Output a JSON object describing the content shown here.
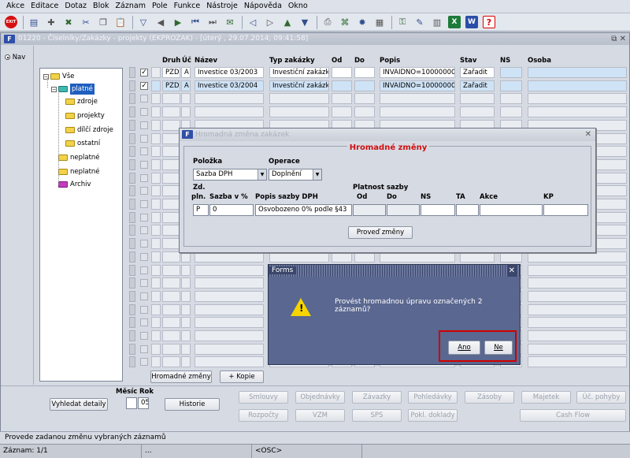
{
  "menu": [
    "Akce",
    "Editace",
    "Dotaz",
    "Blok",
    "Záznam",
    "Pole",
    "Funkce",
    "Nástroje",
    "Nápověda",
    "Okno"
  ],
  "toolbar": {
    "exit_label": "EXIT",
    "icons": [
      "exit-icon",
      "save-icon",
      "new-record-icon",
      "clear-icon",
      "cut-icon",
      "copy-icon",
      "paste-icon",
      "filter-icon",
      "prev-icon",
      "next-icon",
      "first-icon",
      "last-icon",
      "email-icon",
      "prev-record-icon",
      "next-record-icon",
      "up-icon",
      "down-icon",
      "print-icon",
      "attach-icon",
      "settings-icon",
      "calculator-icon",
      "key-icon",
      "edit-icon",
      "table-icon",
      "excel-icon",
      "word-icon",
      "help-icon"
    ]
  },
  "form": {
    "title": "01220 - Číselníky/Zakázky - projekty (EKPROZAK) - [úterý , 29.07.2014; 09:41:58]",
    "nav_label": "Nav",
    "tree": [
      {
        "label": "Vše",
        "level": 0,
        "color": "yellow",
        "toggle": "−"
      },
      {
        "label": "platné",
        "level": 1,
        "color": "teal",
        "toggle": "−",
        "selected": true
      },
      {
        "label": "zdroje",
        "level": 2,
        "color": "yellow"
      },
      {
        "label": "projekty",
        "level": 2,
        "color": "yellow"
      },
      {
        "label": "dílčí zdroje",
        "level": 2,
        "color": "yellow"
      },
      {
        "label": "ostatní",
        "level": 2,
        "color": "yellow"
      },
      {
        "label": "neplatné",
        "level": 1,
        "color": "yellow"
      },
      {
        "label": "neplatné",
        "level": 1,
        "color": "yellow"
      },
      {
        "label": "Archiv",
        "level": 1,
        "color": "magenta"
      }
    ],
    "columns": [
      "Druh",
      "Úč",
      "Název",
      "Typ zakázky",
      "Od",
      "Do",
      "Popis",
      "Stav",
      "NS",
      "Osoba"
    ],
    "rows": [
      {
        "checked": "✓",
        "druh": "PZD",
        "uc": "A",
        "nazev": "Investice 03/2003",
        "typ": "Investiční zakázk",
        "popis": "INVAIDNO=100000000",
        "stav": "Zařadit"
      },
      {
        "checked": "✓",
        "druh": "PZD",
        "uc": "A",
        "nazev": "Investice 03/2004",
        "typ": "Investiční zakázk",
        "popis": "INVAIDNO=100000002",
        "stav": "Zařadit"
      }
    ],
    "buttons": {
      "hromadne": "Hromadné změny",
      "kopie": "+ Kopie",
      "vyhledat": "Vyhledat detaily",
      "mesic_label": "Měsíc",
      "rok_label": "Rok",
      "rok_value": "05",
      "historie": "Historie"
    },
    "action_buttons_row1": [
      "Smlouvy",
      "Objednávky",
      "Závazky",
      "Pohledávky",
      "Zásoby",
      "Majetek",
      "Úč. pohyby"
    ],
    "action_buttons_row2": [
      "Rozpočty",
      "VZM",
      "SPS",
      "Pokl. doklady",
      "Cash Flow"
    ]
  },
  "dialog_bulk": {
    "title": "Hromadná změna zakázek",
    "heading": "Hromadné změny",
    "polozka_label": "Položka",
    "polozka_value": "Sazba DPH",
    "operace_label": "Operace",
    "operace_value": "Doplnění",
    "zd_label": "Zd.",
    "pln_label": "pln.",
    "sazba_label": "Sazba v %",
    "popis_label": "Popis sazby DPH",
    "platnost_label": "Platnost sazby",
    "od_label": "Od",
    "do_label": "Do",
    "ns_label": "NS",
    "ta_label": "TA",
    "akce_label": "Akce",
    "kp_label": "KP",
    "zd_value": "P",
    "sazba_value": "0",
    "popis_value": "Osvobozeno 0% podle §43",
    "proved_button": "Proveď změny"
  },
  "dialog_confirm": {
    "title": "Forms",
    "message": "Provést hromadnou úpravu označených 2 záznamů?",
    "yes": "Ano",
    "no": "Ne"
  },
  "status": {
    "message": "Provede zadanou změnu vybraných záznamů",
    "record": "Záznam: 1/1",
    "ellipsis": "...",
    "osc": "<OSC>"
  },
  "colors": {
    "highlight": "#d00000",
    "heading": "#d01010",
    "selection": "#1f5fbf"
  }
}
